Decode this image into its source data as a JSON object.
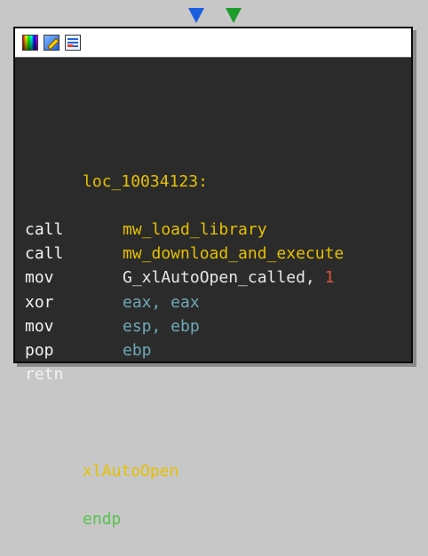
{
  "node": {
    "header_icons": [
      "color-palette-icon",
      "edit-icon",
      "graph-view-icon"
    ],
    "label": "loc_10034123:",
    "instructions": [
      {
        "mnemonic": "call",
        "operands": [
          {
            "text": "mw_load_library",
            "kind": "name"
          }
        ]
      },
      {
        "mnemonic": "call",
        "operands": [
          {
            "text": "mw_download_and_execute",
            "kind": "name"
          }
        ]
      },
      {
        "mnemonic": "mov",
        "operands": [
          {
            "text": "G_xlAutoOpen_called, ",
            "kind": "var"
          },
          {
            "text": "1",
            "kind": "num"
          }
        ]
      },
      {
        "mnemonic": "xor",
        "operands": [
          {
            "text": "eax, eax",
            "kind": "reg"
          }
        ]
      },
      {
        "mnemonic": "mov",
        "operands": [
          {
            "text": "esp, ebp",
            "kind": "reg"
          }
        ]
      },
      {
        "mnemonic": "pop",
        "operands": [
          {
            "text": "ebp",
            "kind": "reg"
          }
        ]
      },
      {
        "mnemonic": "retn",
        "operands": []
      }
    ],
    "footer": {
      "function": "xlAutoOpen",
      "keyword": "endp"
    }
  },
  "colors": {
    "background": "#c7c7c7",
    "node_bg": "#2b2b2b",
    "label": "#e5c100",
    "register": "#6fa8b8",
    "number": "#e0533c",
    "keyword": "#58c24b",
    "incoming_arrow_blue": "#1b5fe0",
    "incoming_arrow_green": "#1e9c2a"
  }
}
